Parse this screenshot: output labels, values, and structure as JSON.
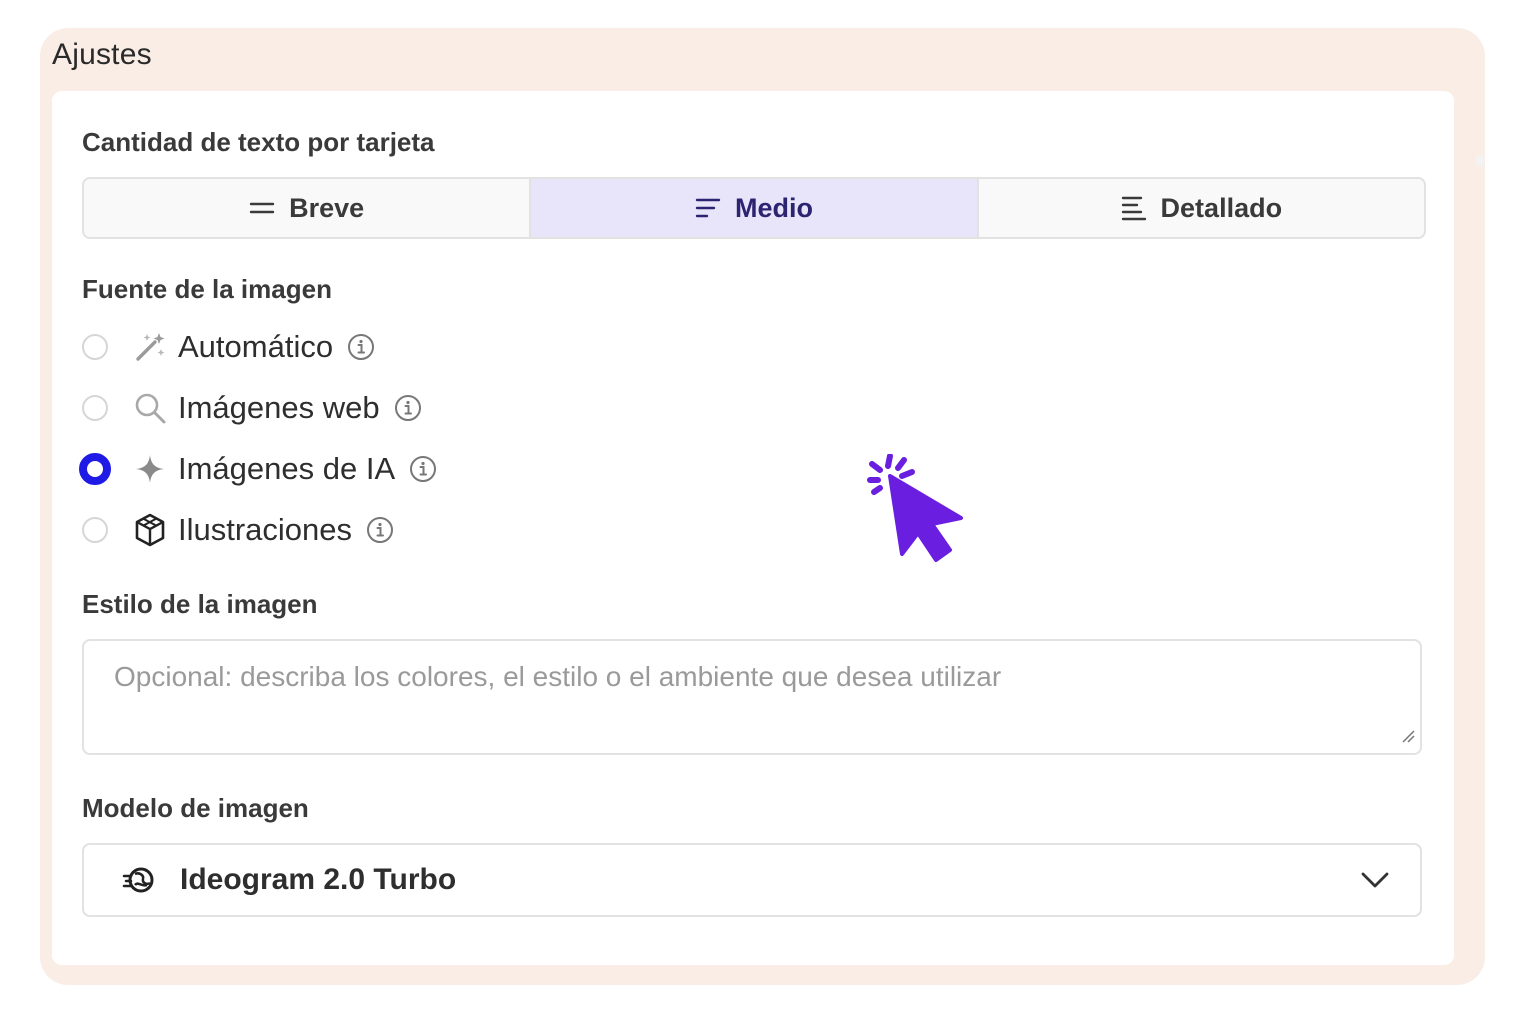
{
  "panel": {
    "title": "Ajustes"
  },
  "text_amount": {
    "label": "Cantidad de texto por tarjeta",
    "options": [
      {
        "label": "Breve",
        "icon": "short-lines-icon",
        "selected": false
      },
      {
        "label": "Medio",
        "icon": "medium-lines-icon",
        "selected": true
      },
      {
        "label": "Detallado",
        "icon": "detailed-lines-icon",
        "selected": false
      }
    ],
    "selected_bg": "#e8e5fb"
  },
  "image_source": {
    "label": "Fuente de la imagen",
    "options": [
      {
        "label": "Automático",
        "icon": "magic-wand-icon",
        "checked": false
      },
      {
        "label": "Imágenes web",
        "icon": "search-icon",
        "checked": false
      },
      {
        "label": "Imágenes de IA",
        "icon": "sparkle-icon",
        "checked": true
      },
      {
        "label": "Ilustraciones",
        "icon": "illustration-cube-icon",
        "checked": false
      }
    ],
    "accent": "#1f1ae6"
  },
  "image_style": {
    "label": "Estilo de la imagen",
    "placeholder": "Opcional: describa los colores, el estilo o el ambiente que desea utilizar",
    "value": ""
  },
  "image_model": {
    "label": "Modelo de imagen",
    "selected": "Ideogram 2.0 Turbo",
    "icon": "ideogram-logo-icon"
  },
  "cursor_color": "#6a1ee0"
}
